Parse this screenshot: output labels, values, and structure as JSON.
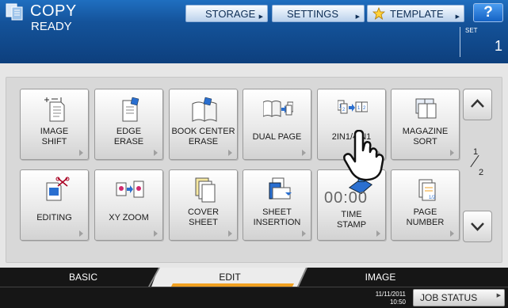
{
  "header": {
    "title": "COPY",
    "status": "READY",
    "set_label": "SET",
    "set_count": "1",
    "help_label": "?",
    "buttons": {
      "storage": "STORAGE",
      "settings": "SETTINGS",
      "template": "TEMPLATE"
    }
  },
  "functions": {
    "image_shift": "IMAGE\nSHIFT",
    "edge_erase": "EDGE\nERASE",
    "book_center_erase": "BOOK CENTER\nERASE",
    "dual_page": "DUAL PAGE",
    "2in1_4in1": "2IN1/4IN1",
    "magazine_sort": "MAGAZINE\nSORT",
    "editing": "EDITING",
    "xy_zoom": "XY ZOOM",
    "cover_sheet": "COVER\nSHEET",
    "sheet_insertion": "SHEET\nINSERTION",
    "time_stamp": "TIME\nSTAMP",
    "page_number": "PAGE\nNUMBER",
    "time_stamp_icon_text": "00:00"
  },
  "pagination": {
    "current": "1",
    "total": "2"
  },
  "tabs": {
    "basic": "BASIC",
    "edit": "EDIT",
    "image": "IMAGE"
  },
  "footer": {
    "date": "11/11/2011",
    "time": "10:50",
    "job_status": "JOB STATUS"
  },
  "colors": {
    "header_blue": "#14539a",
    "active_tab_accent": "#f0a020",
    "help_blue": "#1462c4"
  }
}
